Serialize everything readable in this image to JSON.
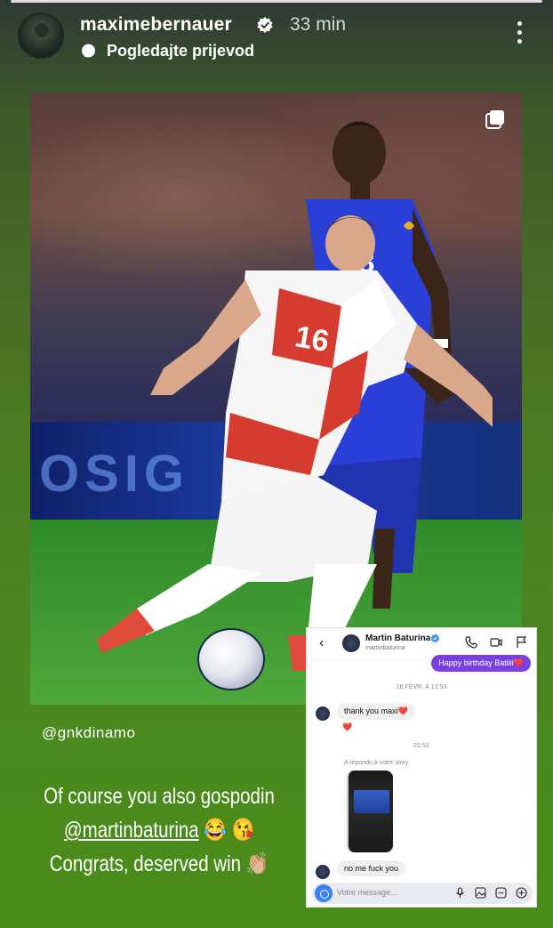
{
  "story": {
    "username": "maximebernauer",
    "time_ago": "33 min",
    "translate_label": "Pogledajte prijevod",
    "photo_tag": "@gnkdinamo",
    "caption_line1": "Of course you also gospodin",
    "caption_mention": "@martinbaturina",
    "caption_emoji1": "😂 😘",
    "caption_line3": "Congrats, deserved win 👏🏼",
    "jersey_red_number": "16",
    "jersey_blue_number": "8",
    "board_text": "OSIG"
  },
  "dm": {
    "name": "Martin Baturina",
    "handle": "martinbaturina",
    "sent_message": "Happy birthday Batiiii❤️",
    "date_label": "16 FÉVR. À 13:53",
    "received_1": "thank you maxi❤️",
    "reaction": "❤️",
    "time_label": "22:52",
    "replied_label": "A répondu à votre story",
    "received_2": "no me fuck you",
    "input_placeholder": "Votre message..."
  },
  "colors": {
    "accent_purple": "#7b3fe0",
    "verified_blue": "#3897f0",
    "background_green": "#4a8a1e"
  },
  "icons": [
    "verified-badge-icon",
    "translate-icon",
    "more-options-icon",
    "carousel-icon",
    "back-arrow-icon",
    "phone-icon",
    "video-icon",
    "flag-icon",
    "camera-icon",
    "microphone-icon",
    "gallery-icon",
    "sticker-icon",
    "plus-icon"
  ]
}
